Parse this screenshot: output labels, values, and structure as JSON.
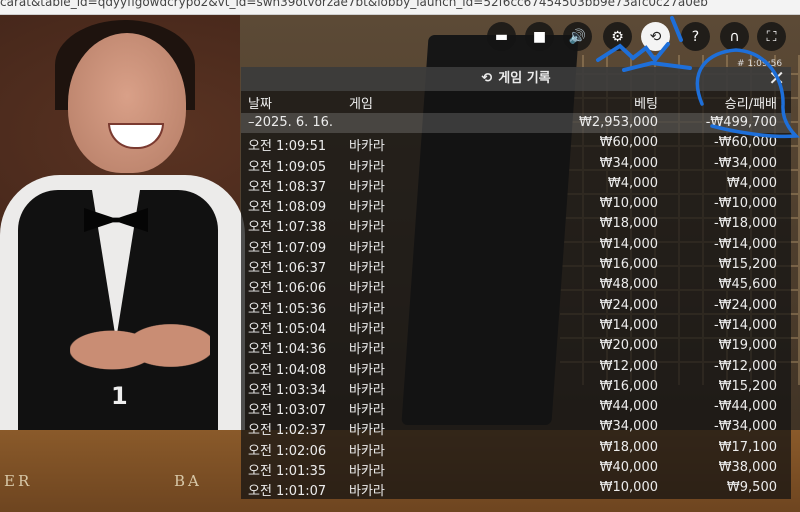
{
  "browser": {
    "url": "carat&table_id=qdyyfigowdcrypo2&vt_id=swn39otvorzae7bt&lobby_launch_id=52f6cc67454503bb9e73afc0c27a0eb"
  },
  "toolbar": {
    "buttons": [
      {
        "name": "chat-icon",
        "glyph": "▬"
      },
      {
        "name": "video-icon",
        "glyph": "■"
      },
      {
        "name": "volume-icon",
        "glyph": "🔊"
      },
      {
        "name": "settings-icon",
        "glyph": "⚙"
      },
      {
        "name": "history-icon",
        "glyph": "⟲",
        "active": true
      },
      {
        "name": "help-icon",
        "glyph": "?"
      },
      {
        "name": "headset-icon",
        "glyph": "∩"
      },
      {
        "name": "fullscreen-icon",
        "glyph": "⛶"
      }
    ],
    "timer": "# 1:09:56"
  },
  "scene": {
    "table_number": "1",
    "table_left": "ER",
    "table_right": "BA"
  },
  "history": {
    "title": "게임 기록",
    "close": "✕",
    "columns": {
      "date": "날짜",
      "game": "게임",
      "bet": "베팅",
      "result": "승리/패배"
    },
    "total": {
      "date": "–2025. 6. 16.",
      "bet": "₩2,953,000",
      "result": "-₩499,700"
    },
    "rows": [
      {
        "time": "오전 1:09:51",
        "game": "바카라",
        "bet": "₩60,000",
        "result": "-₩60,000"
      },
      {
        "time": "오전 1:09:05",
        "game": "바카라",
        "bet": "₩34,000",
        "result": "-₩34,000"
      },
      {
        "time": "오전 1:08:37",
        "game": "바카라",
        "bet": "₩4,000",
        "result": "₩4,000"
      },
      {
        "time": "오전 1:08:09",
        "game": "바카라",
        "bet": "₩10,000",
        "result": "-₩10,000"
      },
      {
        "time": "오전 1:07:38",
        "game": "바카라",
        "bet": "₩18,000",
        "result": "-₩18,000"
      },
      {
        "time": "오전 1:07:09",
        "game": "바카라",
        "bet": "₩14,000",
        "result": "-₩14,000"
      },
      {
        "time": "오전 1:06:37",
        "game": "바카라",
        "bet": "₩16,000",
        "result": "₩15,200"
      },
      {
        "time": "오전 1:06:06",
        "game": "바카라",
        "bet": "₩48,000",
        "result": "₩45,600"
      },
      {
        "time": "오전 1:05:36",
        "game": "바카라",
        "bet": "₩24,000",
        "result": "-₩24,000"
      },
      {
        "time": "오전 1:05:04",
        "game": "바카라",
        "bet": "₩14,000",
        "result": "-₩14,000"
      },
      {
        "time": "오전 1:04:36",
        "game": "바카라",
        "bet": "₩20,000",
        "result": "₩19,000"
      },
      {
        "time": "오전 1:04:08",
        "game": "바카라",
        "bet": "₩12,000",
        "result": "-₩12,000"
      },
      {
        "time": "오전 1:03:34",
        "game": "바카라",
        "bet": "₩16,000",
        "result": "₩15,200"
      },
      {
        "time": "오전 1:03:07",
        "game": "바카라",
        "bet": "₩44,000",
        "result": "-₩44,000"
      },
      {
        "time": "오전 1:02:37",
        "game": "바카라",
        "bet": "₩34,000",
        "result": "-₩34,000"
      },
      {
        "time": "오전 1:02:06",
        "game": "바카라",
        "bet": "₩18,000",
        "result": "₩17,100"
      },
      {
        "time": "오전 1:01:35",
        "game": "바카라",
        "bet": "₩40,000",
        "result": "₩38,000"
      },
      {
        "time": "오전 1:01:07",
        "game": "바카라",
        "bet": "₩10,000",
        "result": "₩9,500"
      }
    ]
  },
  "colors": {
    "annotation": "#1e6fd9",
    "panel_bg": "#121212"
  }
}
